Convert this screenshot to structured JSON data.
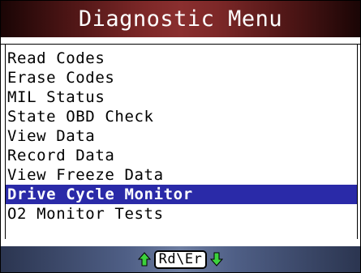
{
  "title": "Diagnostic Menu",
  "menu": {
    "items": [
      {
        "label": "Read Codes"
      },
      {
        "label": "Erase Codes"
      },
      {
        "label": "MIL Status"
      },
      {
        "label": "State OBD Check"
      },
      {
        "label": "View Data"
      },
      {
        "label": "Record Data"
      },
      {
        "label": "View Freeze Data"
      },
      {
        "label": "Drive Cycle Monitor"
      },
      {
        "label": "O2 Monitor Tests"
      }
    ],
    "selected_index": 7
  },
  "footer": {
    "key_label": "Rd\\Er"
  },
  "icons": {
    "up": "up-arrow-icon",
    "down": "down-arrow-icon"
  },
  "colors": {
    "title_bar": "#7d2828",
    "selection": "#2a2aa8",
    "arrow": "#3cd23c",
    "footer_bar": "#4f5f86"
  }
}
